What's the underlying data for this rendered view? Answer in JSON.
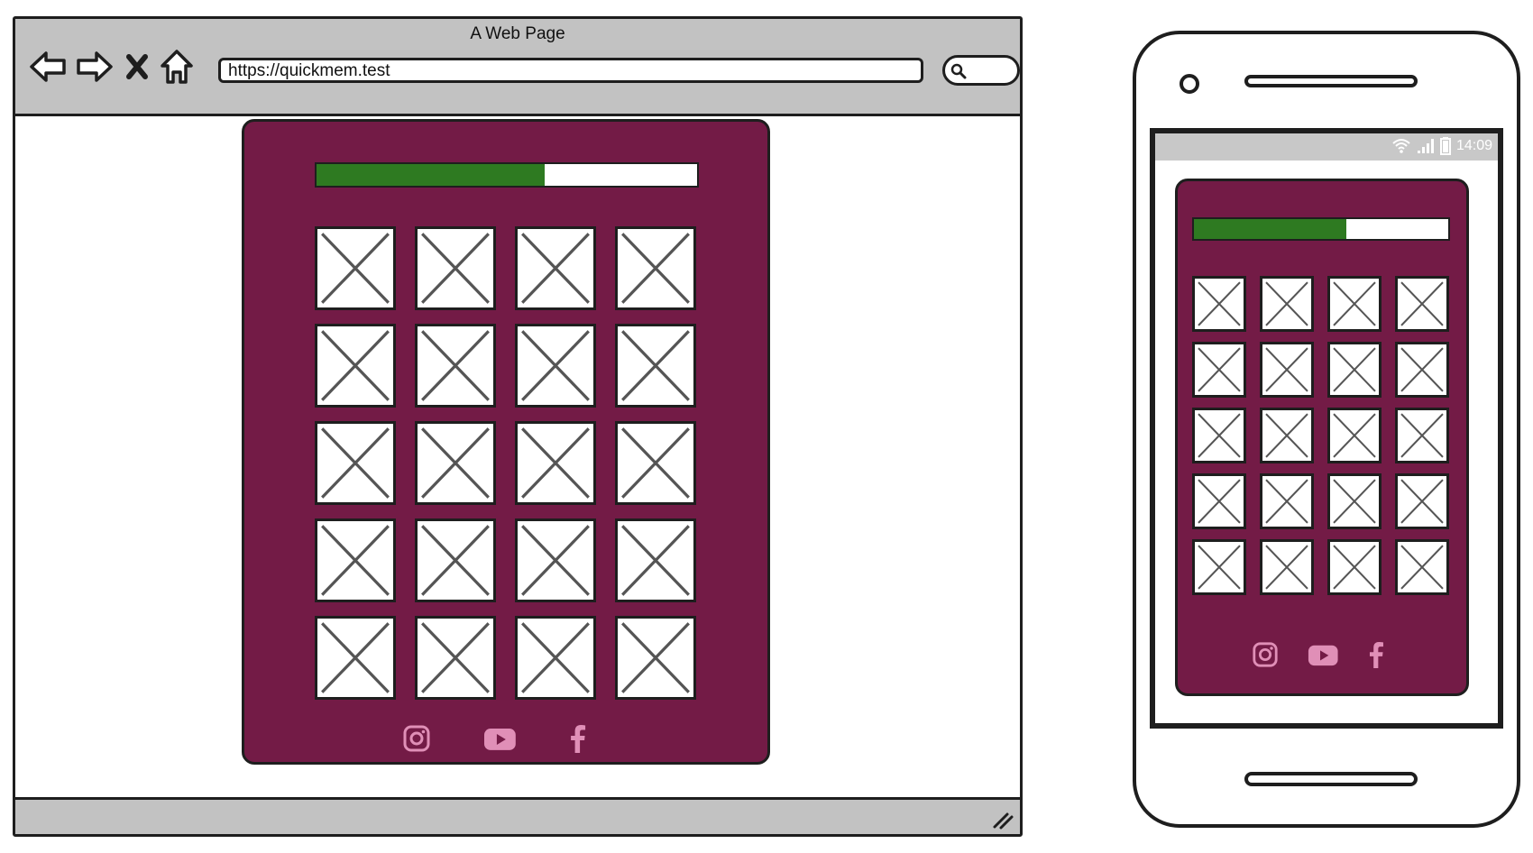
{
  "browser": {
    "title": "A Web Page",
    "url": "https://quickmem.test",
    "nav_icons": [
      "back-arrow-icon",
      "forward-arrow-icon",
      "close-icon",
      "home-icon"
    ]
  },
  "game": {
    "progress_fraction": 0.6,
    "grid": {
      "columns": 4,
      "rows": 5,
      "tile_icon": "image-placeholder-icon"
    },
    "socials": [
      "instagram-icon",
      "youtube-icon",
      "facebook-icon"
    ]
  },
  "phone": {
    "status_time": "14:09",
    "status_icons": [
      "wifi-icon",
      "signal-icon",
      "battery-icon"
    ]
  },
  "colors": {
    "card": "#731b46",
    "progress_fill": "#2e7a21",
    "chrome": "#c2c2c2",
    "social_icon": "#e08fb7"
  }
}
